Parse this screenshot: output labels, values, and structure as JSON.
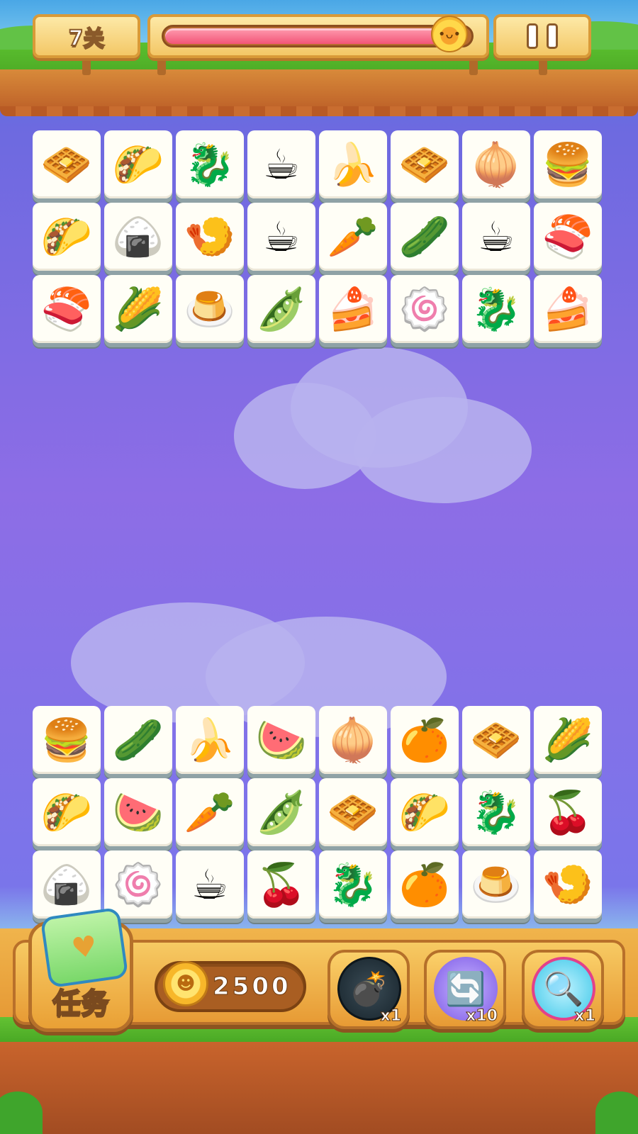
{
  "hud": {
    "level_label": "7关",
    "progress": 0.93,
    "flower_icon": "sunflower-face-icon",
    "pause_icon": "pause-icon"
  },
  "board_top": {
    "tiles": [
      {
        "name": "waffle",
        "glyph": "🧇"
      },
      {
        "name": "taco",
        "glyph": "🌮"
      },
      {
        "name": "dragonfruit",
        "glyph": "🐉"
      },
      {
        "name": "coffee-cup",
        "glyph": "☕"
      },
      {
        "name": "banana",
        "glyph": "🍌"
      },
      {
        "name": "waffle",
        "glyph": "🧇"
      },
      {
        "name": "radish",
        "glyph": "🧅"
      },
      {
        "name": "burger",
        "glyph": "🍔"
      },
      {
        "name": "taco",
        "glyph": "🌮"
      },
      {
        "name": "onigiri",
        "glyph": "🍙"
      },
      {
        "name": "fried-shrimp",
        "glyph": "🍤"
      },
      {
        "name": "coffee-cup",
        "glyph": "☕"
      },
      {
        "name": "carrot",
        "glyph": "🥕"
      },
      {
        "name": "cucumber",
        "glyph": "🥒"
      },
      {
        "name": "coffee-cup",
        "glyph": "☕"
      },
      {
        "name": "roe-sushi",
        "glyph": "🍣"
      },
      {
        "name": "roe-sushi",
        "glyph": "🍣"
      },
      {
        "name": "corn",
        "glyph": "🌽"
      },
      {
        "name": "pudding",
        "glyph": "🍮"
      },
      {
        "name": "peas",
        "glyph": "🫛"
      },
      {
        "name": "cake",
        "glyph": "🍰"
      },
      {
        "name": "sushi-roll",
        "glyph": "🍥"
      },
      {
        "name": "dragonfruit",
        "glyph": "🐉"
      },
      {
        "name": "cake",
        "glyph": "🍰"
      }
    ]
  },
  "board_bottom": {
    "tiles": [
      {
        "name": "burger",
        "glyph": "🍔"
      },
      {
        "name": "cucumber",
        "glyph": "🥒"
      },
      {
        "name": "banana",
        "glyph": "🍌"
      },
      {
        "name": "watermelon",
        "glyph": "🍉"
      },
      {
        "name": "radish",
        "glyph": "🧅"
      },
      {
        "name": "orange",
        "glyph": "🍊"
      },
      {
        "name": "waffle",
        "glyph": "🧇"
      },
      {
        "name": "corn",
        "glyph": "🌽"
      },
      {
        "name": "taco",
        "glyph": "🌮"
      },
      {
        "name": "watermelon",
        "glyph": "🍉"
      },
      {
        "name": "carrot",
        "glyph": "🥕"
      },
      {
        "name": "peas",
        "glyph": "🫛"
      },
      {
        "name": "waffle",
        "glyph": "🧇"
      },
      {
        "name": "taco",
        "glyph": "🌮"
      },
      {
        "name": "dragonfruit",
        "glyph": "🐉"
      },
      {
        "name": "cherry",
        "glyph": "🍒"
      },
      {
        "name": "onigiri",
        "glyph": "🍙"
      },
      {
        "name": "sushi-roll",
        "glyph": "🍥"
      },
      {
        "name": "coffee-cup",
        "glyph": "☕"
      },
      {
        "name": "cherry",
        "glyph": "🍒"
      },
      {
        "name": "dragonfruit",
        "glyph": "🐉"
      },
      {
        "name": "orange",
        "glyph": "🍊"
      },
      {
        "name": "pudding",
        "glyph": "🍮"
      },
      {
        "name": "fried-shrimp",
        "glyph": "🍤"
      }
    ]
  },
  "bottom_bar": {
    "task_label": "任务",
    "coins": "2500",
    "tools": [
      {
        "name": "bomb",
        "glyph": "💣",
        "count": "x1"
      },
      {
        "name": "shuffle",
        "glyph": "🔄",
        "count": "x10"
      },
      {
        "name": "magnifier",
        "glyph": "🔍",
        "count": "x1"
      }
    ]
  },
  "colors": {
    "progress_fill": "#f25577",
    "sky_purple": "#8d6de6",
    "wood": "#f3c766"
  }
}
